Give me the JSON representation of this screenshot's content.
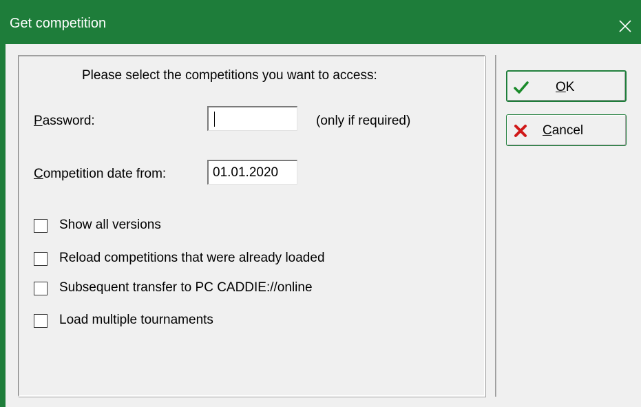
{
  "window": {
    "title": "Get competition",
    "close_icon": "close-icon",
    "accent_color": "#1e7d3a"
  },
  "form": {
    "instruction": "Please select the competitions you want to access:",
    "password": {
      "label_accel": "P",
      "label_rest": "assword:",
      "value": "",
      "hint": "(only if required)"
    },
    "date_from": {
      "label_accel": "C",
      "label_rest": "ompetition date from:",
      "value": "01.01.2020"
    },
    "checkboxes": [
      {
        "label": "Show all versions",
        "checked": false
      },
      {
        "label": "Reload competitions that were already loaded",
        "checked": false
      },
      {
        "label": "Subsequent transfer to PC CADDIE://online",
        "checked": false
      },
      {
        "label": "Load multiple tournaments",
        "checked": false
      }
    ]
  },
  "buttons": {
    "ok": {
      "label_accel": "O",
      "label_rest": "K",
      "icon": "checkmark-icon"
    },
    "cancel": {
      "label_accel": "C",
      "label_rest": "ancel",
      "icon": "red-x-icon"
    }
  }
}
